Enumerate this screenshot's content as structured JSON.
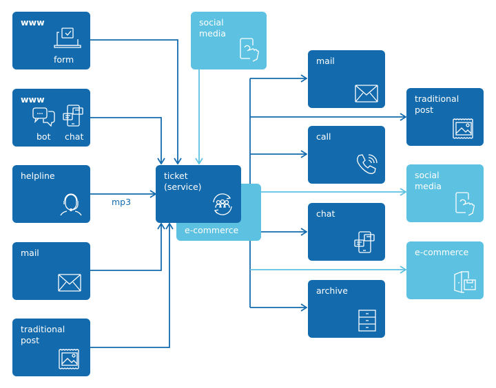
{
  "colors": {
    "dark": "#136aad",
    "light": "#5dc1e2",
    "background": "#ffffff"
  },
  "inputs": [
    {
      "id": "www-form",
      "title": "www",
      "sublabels": [
        "form"
      ],
      "icon": "laptop-form-icon",
      "style": "dark"
    },
    {
      "id": "www-chat",
      "title": "www",
      "sublabels": [
        "bot",
        "chat"
      ],
      "icon": "chat-bubbles-icon",
      "style": "dark"
    },
    {
      "id": "helpline",
      "title": "helpline",
      "icon": "headset-agent-icon",
      "style": "dark"
    },
    {
      "id": "mail-in",
      "title": "mail",
      "icon": "envelope-icon",
      "style": "dark"
    },
    {
      "id": "post-in",
      "title": "traditional\npost",
      "icon": "stamp-icon",
      "style": "dark"
    }
  ],
  "social_in": {
    "title": "social\nmedia",
    "icon": "phone-touch-icon",
    "style": "light"
  },
  "hub": {
    "title": "ticket\n(service)",
    "icon": "team-cycle-icon",
    "secondary": "e-commerce"
  },
  "edge_labels": {
    "helpline": "mp3"
  },
  "outputs_middle": [
    {
      "id": "mail-out",
      "title": "mail",
      "icon": "envelope-icon"
    },
    {
      "id": "call",
      "title": "call",
      "icon": "phone-call-icon"
    },
    {
      "id": "chat",
      "title": "chat",
      "icon": "phone-chat-icon"
    },
    {
      "id": "archive",
      "title": "archive",
      "icon": "cabinet-icon"
    }
  ],
  "outputs_right": [
    {
      "id": "post-out",
      "title": "traditional\npost",
      "icon": "stamp-icon",
      "style": "dark"
    },
    {
      "id": "social-out",
      "title": "social\nmedia",
      "icon": "phone-touch-icon",
      "style": "light"
    },
    {
      "id": "ecommerce-out",
      "title": "e-commerce",
      "icon": "door-package-icon",
      "style": "light"
    }
  ]
}
